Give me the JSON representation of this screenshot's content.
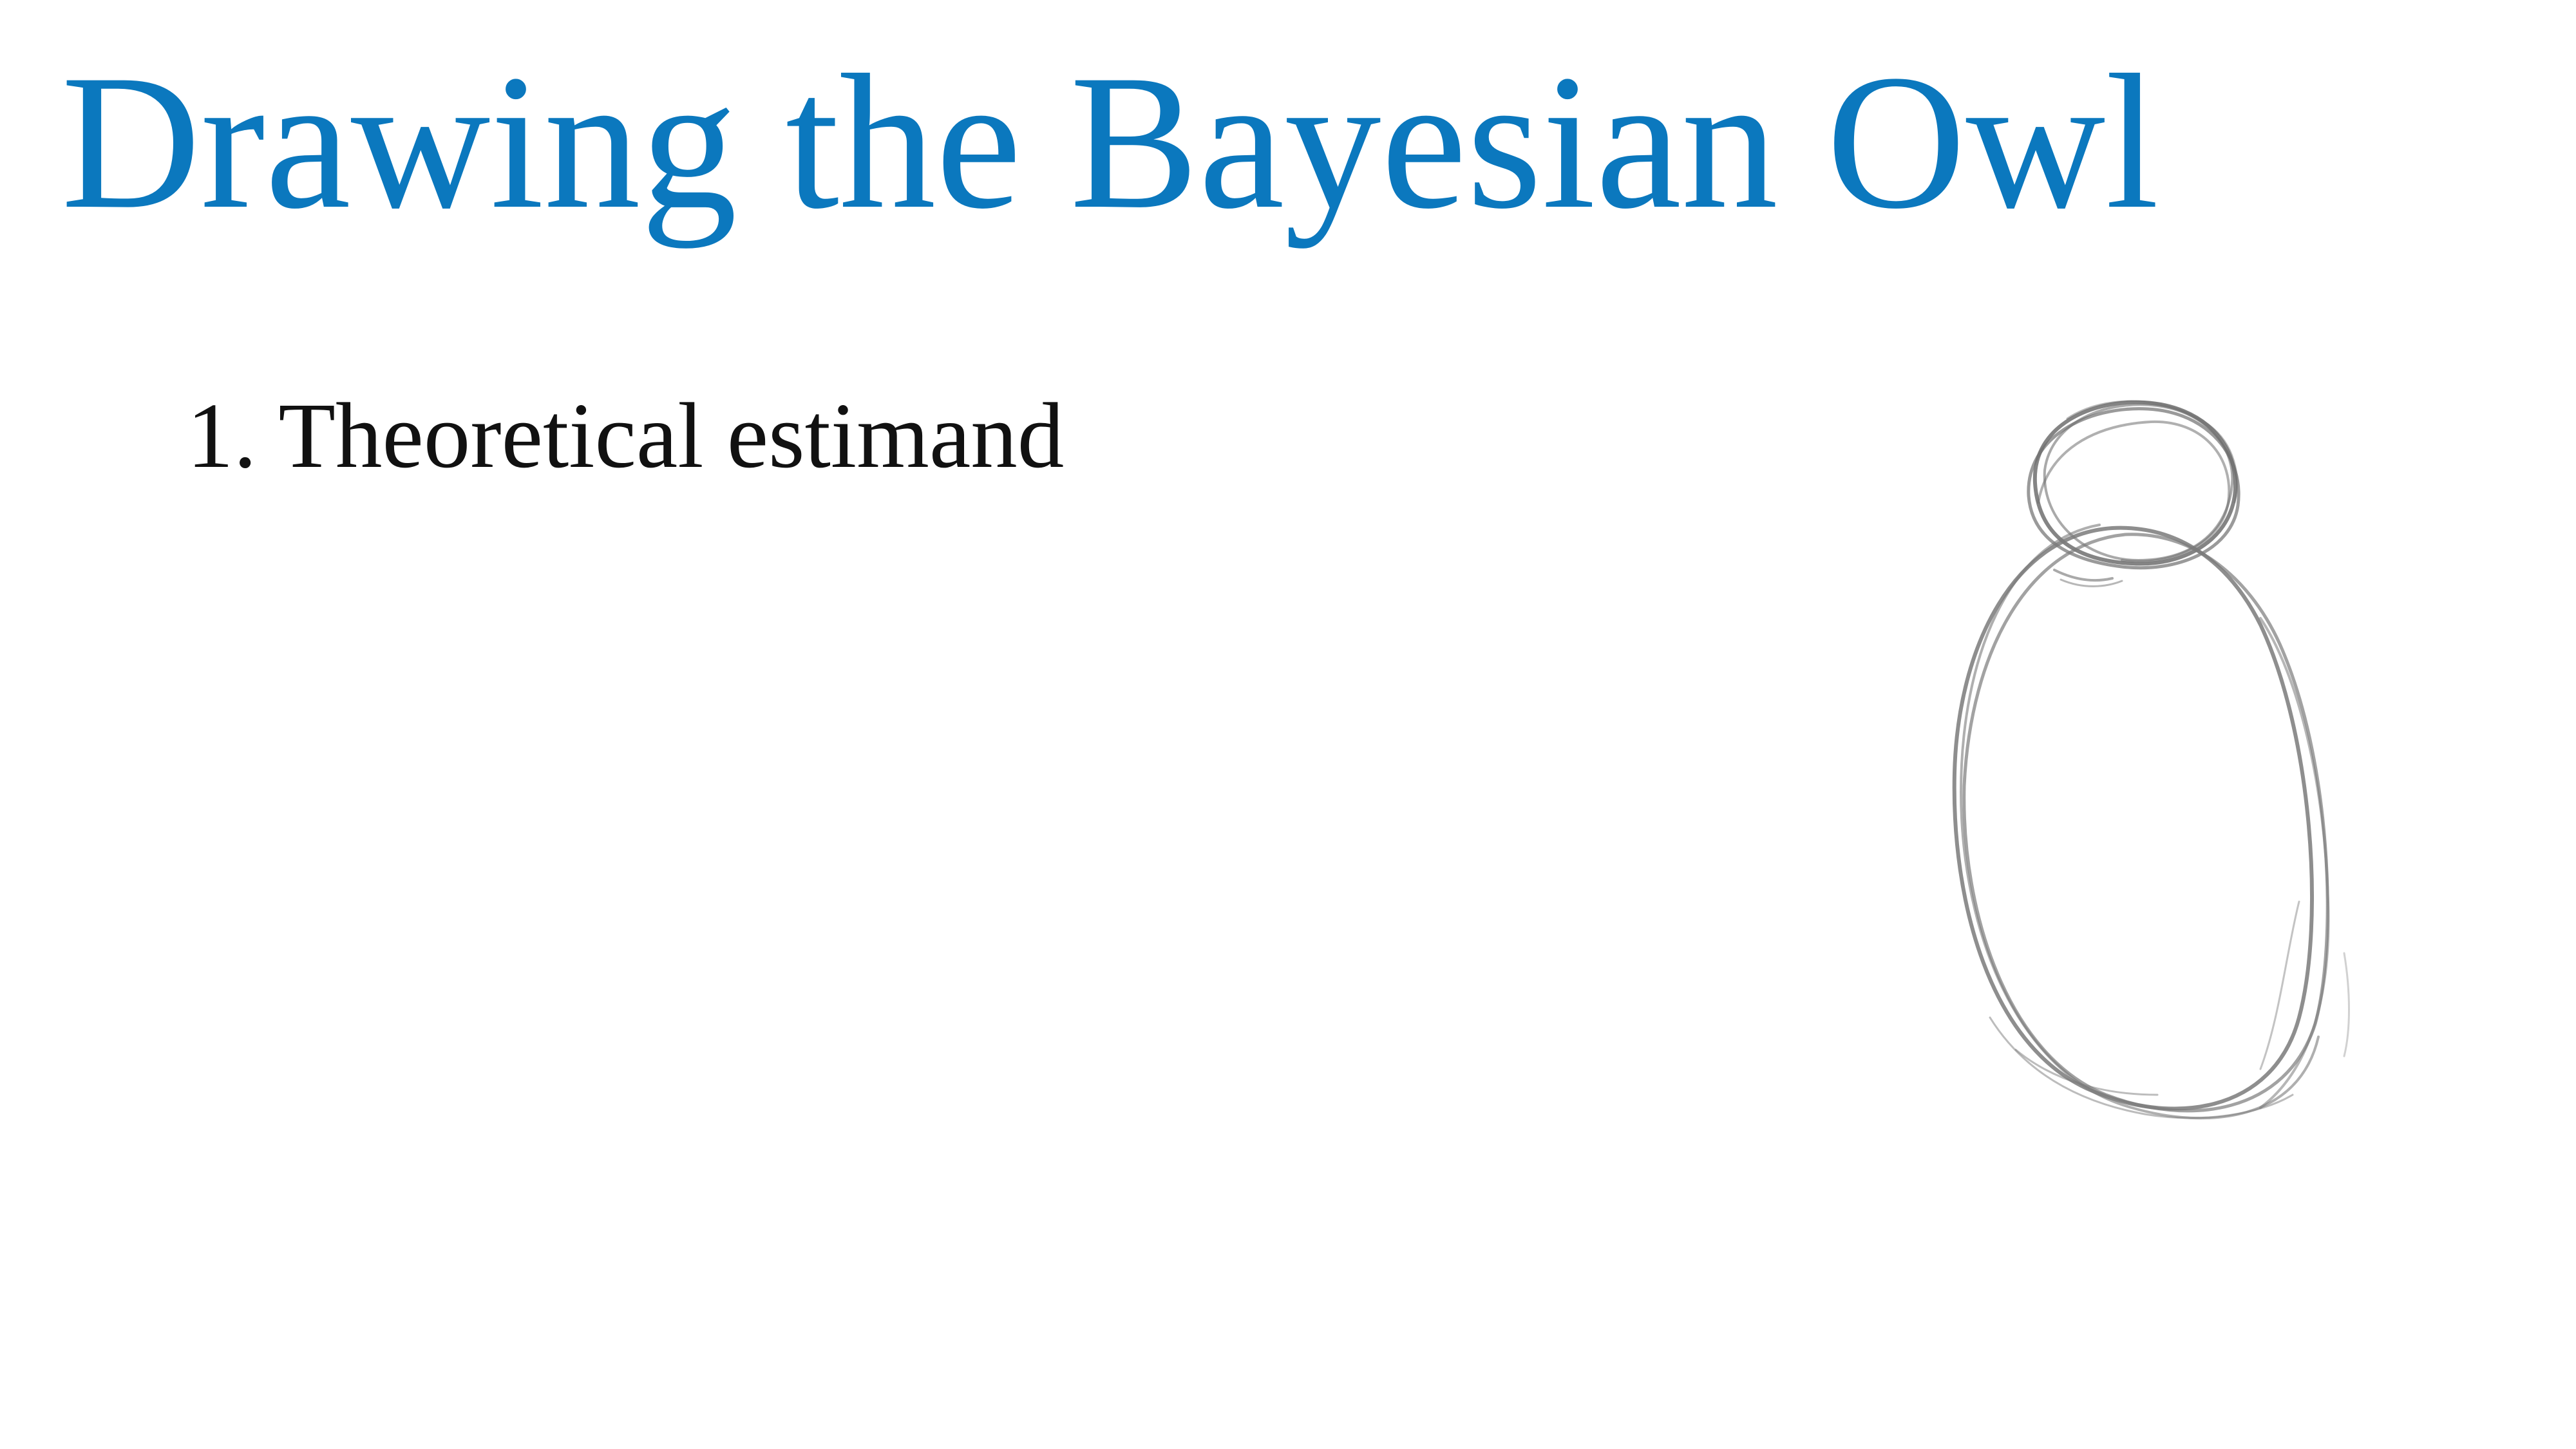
{
  "slide": {
    "title": "Drawing the Bayesian Owl",
    "steps": [
      {
        "number": "1.",
        "label": "Theoretical estimand"
      }
    ]
  },
  "colors": {
    "title": "#0B78BE",
    "body_text": "#111111",
    "sketch_stroke": "#7a7a7a",
    "background": "#ffffff"
  },
  "illustration": {
    "icon": "owl-sketch-icon",
    "description_shape": "pencil sketch of two stacked ovals"
  }
}
